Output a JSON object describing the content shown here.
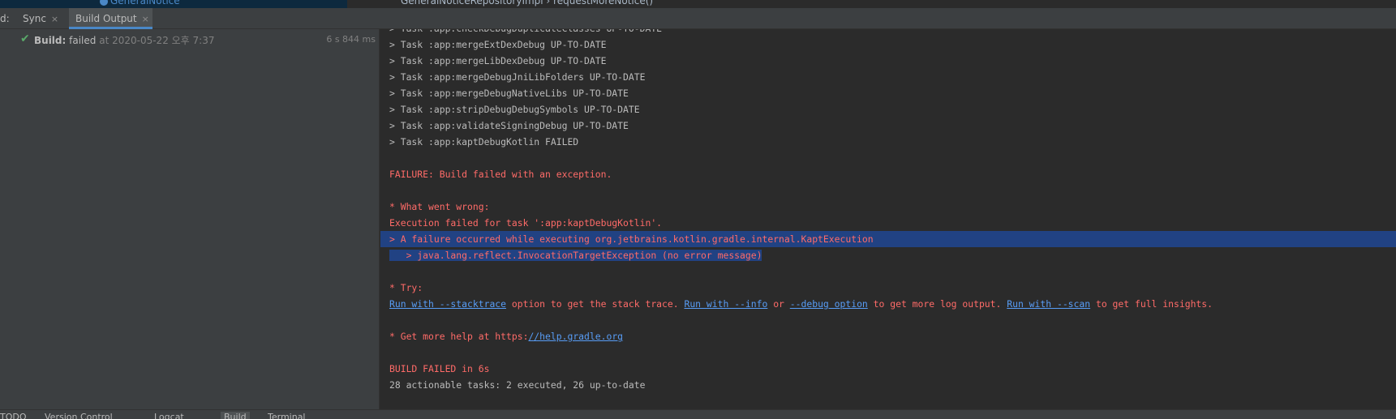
{
  "top_strip": {
    "project_item": "GeneralNotice",
    "breadcrumb": "GeneralNoticeRepositoryImpl  ›  requestMoreNotice()"
  },
  "tool_window": {
    "title": "d:",
    "tabs": [
      {
        "label": "Sync",
        "active": false
      },
      {
        "label": "Build Output",
        "active": true
      }
    ],
    "close_glyph": "×"
  },
  "build_tree": {
    "status_icon": "check-icon",
    "label_bold": "Build:",
    "status": "failed",
    "timestamp": "at 2020-05-22 오후 7:37",
    "duration": "6 s 844 ms"
  },
  "console": {
    "lines": [
      {
        "text": "> Task :app:checkDebugDuplicateClasses UP-TO-DATE",
        "kind": "normal"
      },
      {
        "text": "> Task :app:mergeExtDexDebug UP-TO-DATE",
        "kind": "normal"
      },
      {
        "text": "> Task :app:mergeLibDexDebug UP-TO-DATE",
        "kind": "normal"
      },
      {
        "text": "> Task :app:mergeDebugJniLibFolders UP-TO-DATE",
        "kind": "normal"
      },
      {
        "text": "> Task :app:mergeDebugNativeLibs UP-TO-DATE",
        "kind": "normal"
      },
      {
        "text": "> Task :app:stripDebugDebugSymbols UP-TO-DATE",
        "kind": "normal"
      },
      {
        "text": "> Task :app:validateSigningDebug UP-TO-DATE",
        "kind": "normal"
      },
      {
        "text": "> Task :app:kaptDebugKotlin FAILED",
        "kind": "normal"
      },
      {
        "text": "",
        "kind": "blank"
      },
      {
        "text": "FAILURE: Build failed with an exception.",
        "kind": "error"
      },
      {
        "text": "",
        "kind": "blank"
      },
      {
        "text": "* What went wrong:",
        "kind": "error"
      },
      {
        "text": "Execution failed for task ':app:kaptDebugKotlin'.",
        "kind": "error"
      },
      {
        "text": "> A failure occurred while executing org.jetbrains.kotlin.gradle.internal.KaptExecution",
        "kind": "error-selected"
      },
      {
        "text": "   > java.lang.reflect.InvocationTargetException (no error message)",
        "kind": "error-selected-partial"
      },
      {
        "text": "",
        "kind": "blank"
      },
      {
        "text": "* Try:",
        "kind": "error"
      },
      {
        "text": "",
        "kind": "try-links"
      },
      {
        "text": "",
        "kind": "blank"
      },
      {
        "text": "",
        "kind": "help"
      },
      {
        "text": "",
        "kind": "blank"
      },
      {
        "text": "BUILD FAILED in 6s",
        "kind": "error"
      },
      {
        "text": "28 actionable tasks: 2 executed, 26 up-to-date",
        "kind": "normal"
      }
    ],
    "try_line": {
      "link1": "Run with --stacktrace",
      "text1": " option to get the stack trace. ",
      "link2": "Run with --info",
      "text2": " or ",
      "link3": "--debug option",
      "text3": " to get more log output. ",
      "link4": "Run with --scan",
      "text4": " to get full insights."
    },
    "help_line": {
      "prefix": "* Get more help at https:",
      "link": "//help.gradle.org"
    }
  },
  "bottom_strip": {
    "tabs": [
      "TODO",
      "Version Control",
      "Logcat",
      "Build",
      "Terminal"
    ]
  },
  "colors": {
    "error_text": "#ff6b68",
    "link": "#589df6",
    "selection": "#214283",
    "success": "#59a869"
  }
}
